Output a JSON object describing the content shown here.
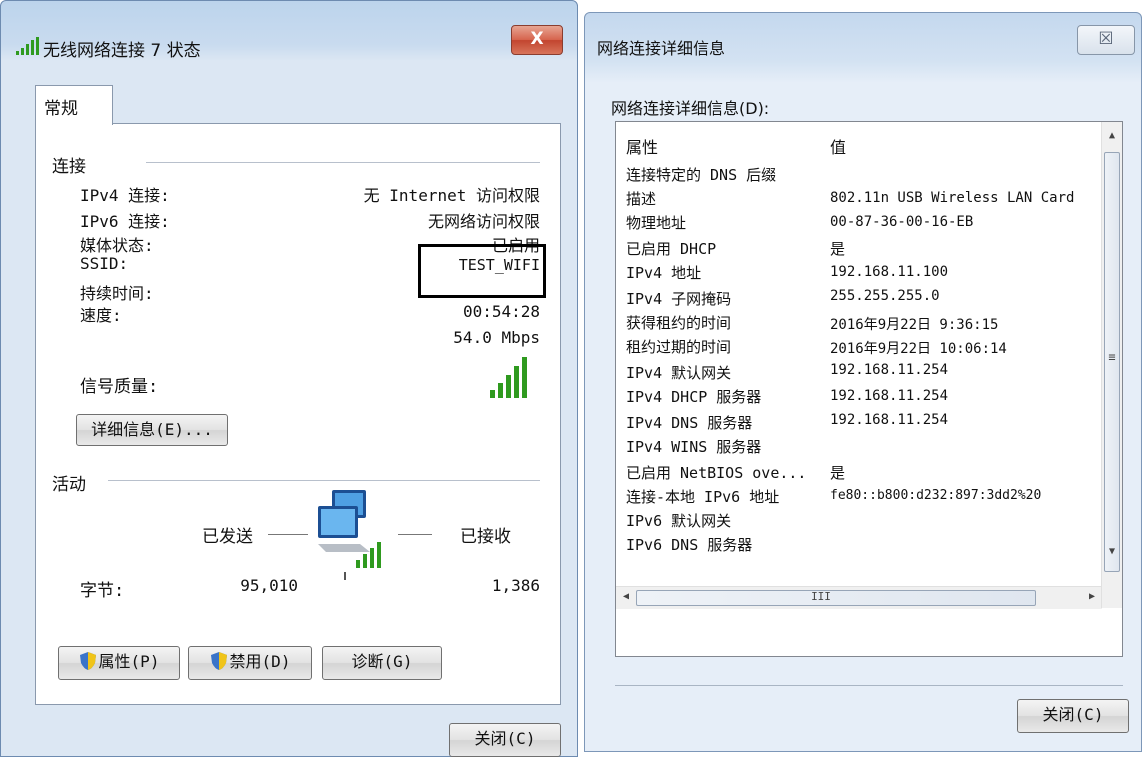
{
  "status_window": {
    "title": "无线网络连接 7 状态",
    "close_label": "X",
    "tab": "常规",
    "connection_header": "连接",
    "rows": [
      {
        "label": "IPv4 连接:",
        "value": "无 Internet 访问权限"
      },
      {
        "label": "IPv6 连接:",
        "value": "无网络访问权限"
      },
      {
        "label": "媒体状态:",
        "value": "已启用"
      },
      {
        "label": "SSID:",
        "value": "TEST_WIFI"
      },
      {
        "label": "持续时间:",
        "value": "00:54:28"
      },
      {
        "label": "速度:",
        "value": "54.0 Mbps"
      }
    ],
    "signal_label": "信号质量:",
    "details_button": "详细信息(E)...",
    "activity_header": "活动",
    "sent_label": "已发送",
    "received_label": "已接收",
    "bytes_label": "字节:",
    "bytes_sent": "95,010",
    "bytes_received": "1,386",
    "properties_button": "属性(P)",
    "disable_button": "禁用(D)",
    "diagnose_button": "诊断(G)",
    "close_button": "关闭(C)"
  },
  "details_window": {
    "title": "网络连接详细信息",
    "close_label": "☒",
    "list_label": "网络连接详细信息(D):",
    "columns": [
      "属性",
      "值"
    ],
    "rows": [
      {
        "property": "连接特定的 DNS 后缀",
        "value": ""
      },
      {
        "property": "描述",
        "value": "802.11n USB Wireless LAN Card"
      },
      {
        "property": "物理地址",
        "value": "00-87-36-00-16-EB"
      },
      {
        "property": "已启用 DHCP",
        "value": "是"
      },
      {
        "property": "IPv4 地址",
        "value": "192.168.11.100"
      },
      {
        "property": "IPv4 子网掩码",
        "value": "255.255.255.0"
      },
      {
        "property": "获得租约的时间",
        "value": "2016年9月22日 9:36:15"
      },
      {
        "property": "租约过期的时间",
        "value": "2016年9月22日 10:06:14"
      },
      {
        "property": "IPv4 默认网关",
        "value": "192.168.11.254"
      },
      {
        "property": "IPv4 DHCP 服务器",
        "value": "192.168.11.254"
      },
      {
        "property": "IPv4 DNS 服务器",
        "value": "192.168.11.254"
      },
      {
        "property": "IPv4 WINS 服务器",
        "value": ""
      },
      {
        "property": "已启用 NetBIOS ove...",
        "value": "是"
      },
      {
        "property": "连接-本地 IPv6 地址",
        "value": "fe80::b800:d232:897:3dd2%20"
      },
      {
        "property": "IPv6 默认网关",
        "value": ""
      },
      {
        "property": "IPv6 DNS 服务器",
        "value": ""
      }
    ],
    "hscroll_grip": "III",
    "vscroll_grip": "≡",
    "close_button": "关闭(C)"
  },
  "colors": {
    "highlight_box": "#000000",
    "signal_green": "#2f9a1f",
    "close_red": "#c9452f"
  },
  "icons": [
    "wifi-signal-icon",
    "network-computers-icon",
    "uac-shield-icon"
  ]
}
